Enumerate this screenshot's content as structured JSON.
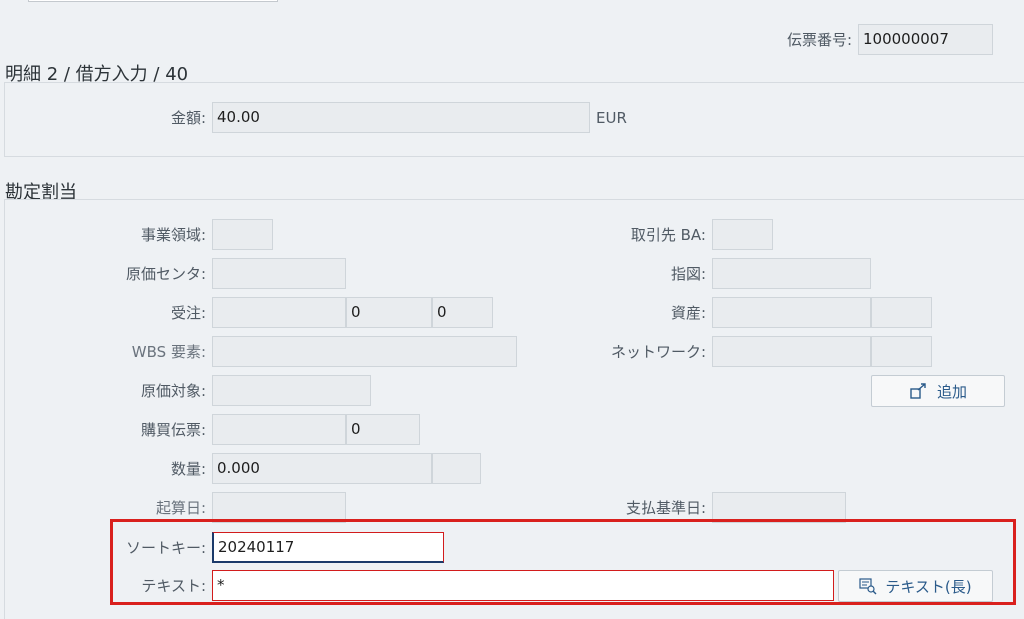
{
  "header": {
    "doc_no_label": "伝票番号:",
    "doc_no_value": "100000007"
  },
  "line_item": {
    "title": "明細 2 / 借方入力 / 40",
    "amount_label": "金額:",
    "amount_value": "40.00",
    "currency": "EUR"
  },
  "assignment": {
    "title": "勘定割当",
    "business_area_label": "事業領域:",
    "cost_center_label": "原価センタ:",
    "sales_order_label": "受注:",
    "sales_order_item": "0",
    "sales_order_schedule": "0",
    "wbs_label": "WBS 要素:",
    "cost_object_label": "原価対象:",
    "purchasing_doc_label": "購買伝票:",
    "purchasing_doc_item": "0",
    "quantity_label": "数量:",
    "quantity_value": "0.000",
    "value_date_label": "起算日:",
    "trading_partner_ba_label": "取引先 BA:",
    "order_label": "指図:",
    "asset_label": "資産:",
    "network_label": "ネットワーク:",
    "baseline_date_label": "支払基準日:",
    "add_button_label": "追加",
    "sort_key_label": "ソートキー:",
    "sort_key_value": "20240117",
    "text_label": "テキスト:",
    "text_value": "*",
    "long_text_button_label": "テキスト(長)"
  },
  "colors": {
    "highlight": "#d9201d",
    "button_text": "#2a5a8a"
  }
}
